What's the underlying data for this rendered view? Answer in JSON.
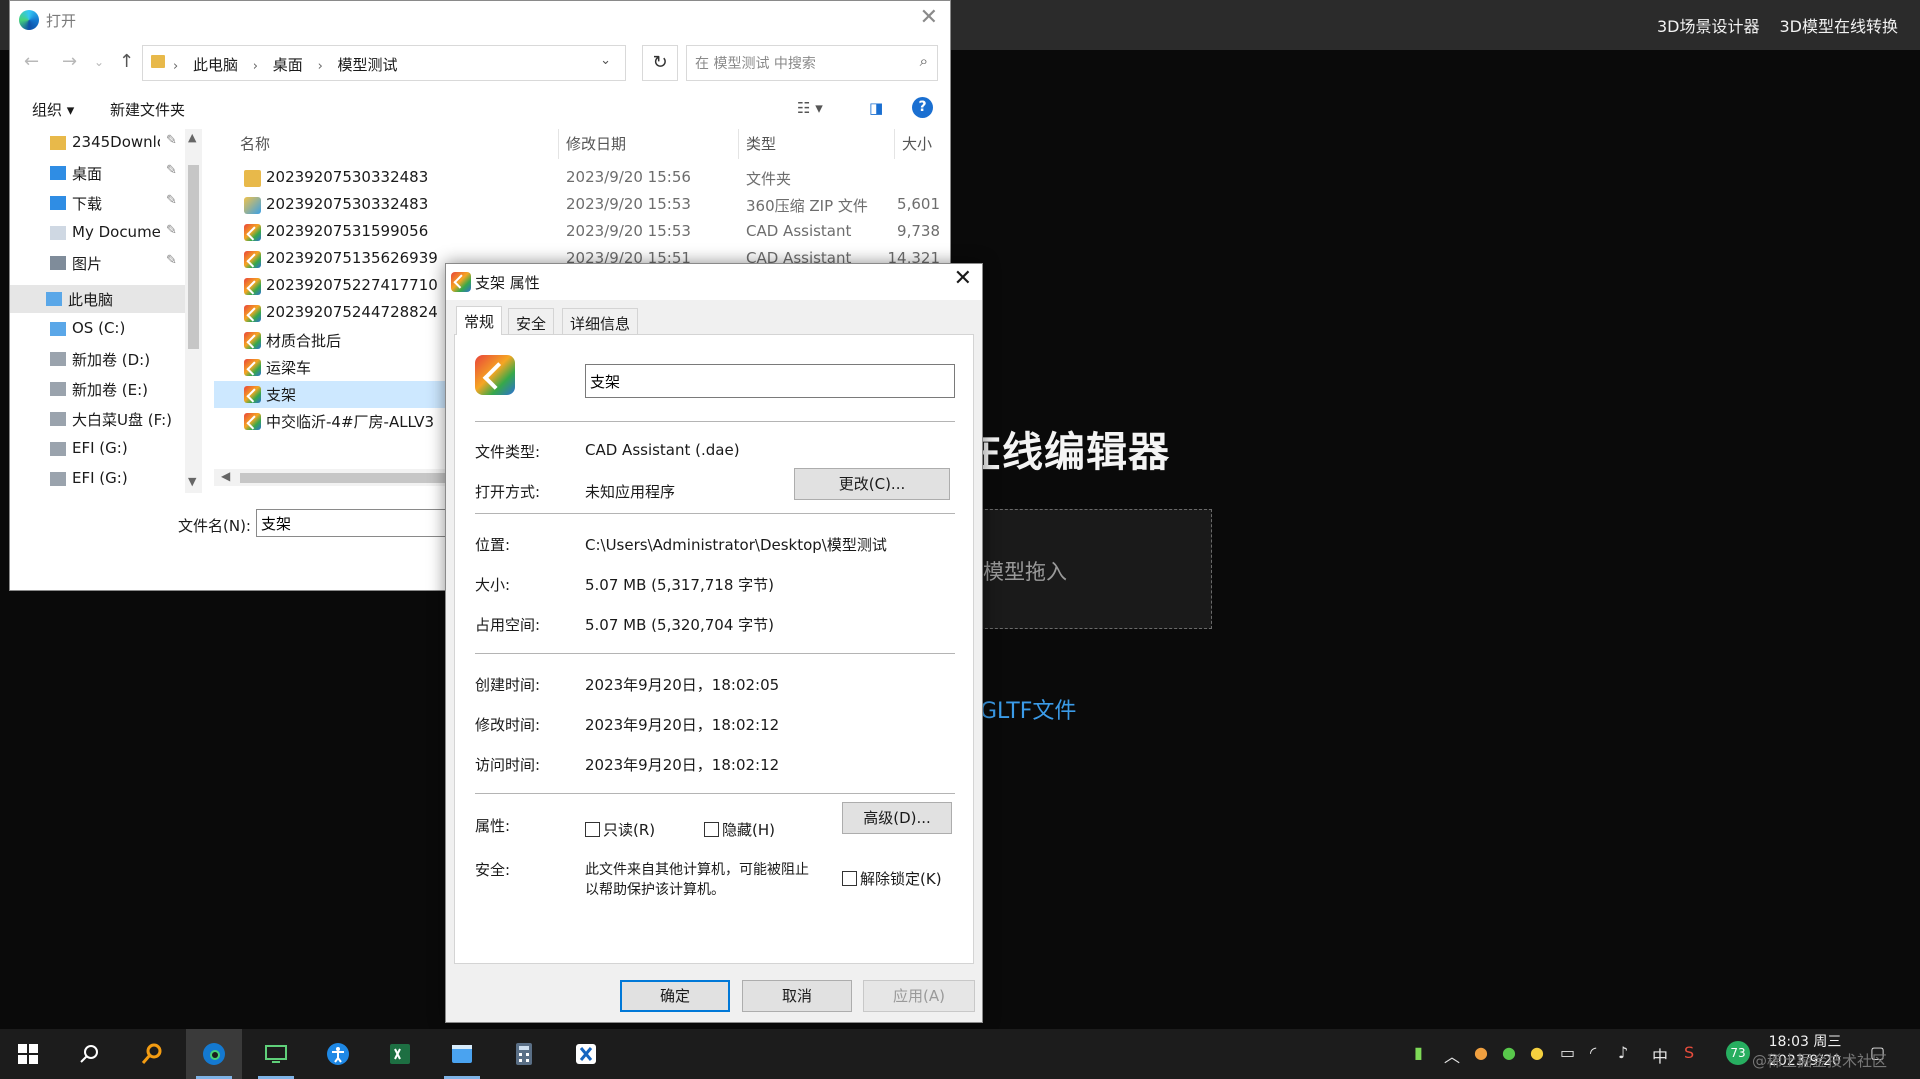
{
  "web": {
    "nav": [
      "3D场景设计器",
      "3D模型在线转换"
    ],
    "heading": "在线编辑器",
    "dropzone_text": "模型拖入",
    "link": "GLTF文件"
  },
  "open_dialog": {
    "title": "打开",
    "breadcrumb": [
      "此电脑",
      "桌面",
      "模型测试"
    ],
    "search_placeholder": "在 模型测试 中搜索",
    "organize": "组织 ▾",
    "new_folder": "新建文件夹",
    "help": "?",
    "nav_items": [
      {
        "label": "2345Downlc",
        "icon": "folder-icon",
        "pinned": true
      },
      {
        "label": "桌面",
        "icon": "desktop-icon",
        "pinned": true
      },
      {
        "label": "下载",
        "icon": "download-icon",
        "pinned": true
      },
      {
        "label": "My Docume",
        "icon": "documents-icon",
        "pinned": true
      },
      {
        "label": "图片",
        "icon": "pictures-icon",
        "pinned": true
      },
      {
        "label": "此电脑",
        "icon": "this-pc-icon",
        "pinned": false
      },
      {
        "label": "OS (C:)",
        "icon": "system-drive-icon",
        "pinned": false
      },
      {
        "label": "新加卷 (D:)",
        "icon": "drive-icon",
        "pinned": false
      },
      {
        "label": "新加卷 (E:)",
        "icon": "drive-icon",
        "pinned": false
      },
      {
        "label": "大白菜U盘 (F:)",
        "icon": "usb-drive-icon",
        "pinned": false
      },
      {
        "label": "EFI (G:)",
        "icon": "drive-icon",
        "pinned": false
      },
      {
        "label": "EFI (G:)",
        "icon": "drive-icon",
        "pinned": false
      }
    ],
    "columns": [
      "名称",
      "修改日期",
      "类型",
      "大小"
    ],
    "files": [
      {
        "name": "20239207530332483",
        "date": "2023/9/20 15:56",
        "type": "文件夹",
        "size": "",
        "icon": "folder-icon"
      },
      {
        "name": "20239207530332483",
        "date": "2023/9/20 15:53",
        "type": "360压缩 ZIP 文件",
        "size": "5,601",
        "icon": "zip-icon"
      },
      {
        "name": "20239207531599056",
        "date": "2023/9/20 15:53",
        "type": "CAD Assistant",
        "size": "9,738",
        "icon": "cad-assistant-icon"
      },
      {
        "name": "202392075135626939",
        "date": "2023/9/20 15:51",
        "type": "CAD Assistant",
        "size": "14,321",
        "icon": "cad-assistant-icon"
      },
      {
        "name": "202392075227417710",
        "date": "",
        "type": "",
        "size": "",
        "icon": "cad-assistant-icon"
      },
      {
        "name": "202392075244728824",
        "date": "",
        "type": "",
        "size": "",
        "icon": "cad-assistant-icon"
      },
      {
        "name": "材质合批后",
        "date": "",
        "type": "",
        "size": "",
        "icon": "cad-assistant-icon"
      },
      {
        "name": "运梁车",
        "date": "",
        "type": "",
        "size": "",
        "icon": "cad-assistant-icon"
      },
      {
        "name": "支架",
        "date": "",
        "type": "",
        "size": "",
        "icon": "cad-assistant-icon",
        "selected": true
      },
      {
        "name": "中交临沂-4#厂房-ALLV3",
        "date": "",
        "type": "",
        "size": "",
        "icon": "cad-assistant-icon"
      }
    ],
    "filename_label": "文件名(N):",
    "filename_value": "支架"
  },
  "properties": {
    "title": "支架 属性",
    "tabs": [
      "常规",
      "安全",
      "详细信息"
    ],
    "name": "支架",
    "file_type_label": "文件类型:",
    "file_type": "CAD Assistant (.dae)",
    "opens_with_label": "打开方式:",
    "opens_with": "未知应用程序",
    "change_btn": "更改(C)...",
    "location_label": "位置:",
    "location": "C:\\Users\\Administrator\\Desktop\\模型测试",
    "size_label": "大小:",
    "size": "5.07 MB (5,317,718 字节)",
    "disk_label": "占用空间:",
    "disk": "5.07 MB (5,320,704 字节)",
    "created_label": "创建时间:",
    "created": "2023年9月20日，18:02:05",
    "modified_label": "修改时间:",
    "modified": "2023年9月20日，18:02:12",
    "accessed_label": "访问时间:",
    "accessed": "2023年9月20日，18:02:12",
    "attr_label": "属性:",
    "readonly": "只读(R)",
    "hidden": "隐藏(H)",
    "advanced_btn": "高级(D)...",
    "security_label": "安全:",
    "security_line1": "此文件来自其他计算机，可能被阻止",
    "security_line2": "以帮助保护该计算机。",
    "unblock": "解除锁定(K)",
    "ok": "确定",
    "cancel": "取消",
    "apply": "应用(A)"
  },
  "taskbar": {
    "ime": "中",
    "badge": "73",
    "time": "18:03 周三",
    "date": "2023/9/20"
  },
  "watermark": "@稀土掘金技术社区",
  "colors": {
    "accent": "#0078d7",
    "link": "#3b9be8",
    "selection": "#cde8ff"
  }
}
